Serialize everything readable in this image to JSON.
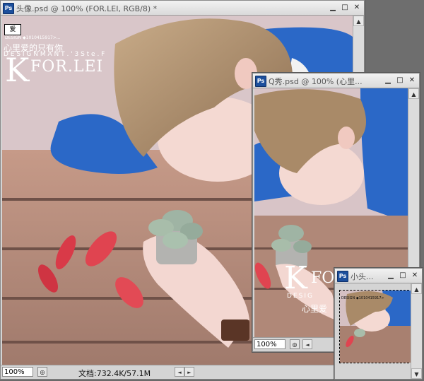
{
  "windows": {
    "main": {
      "title": "头像.psd @ 100% (FOR.LEI, RGB/8) *",
      "zoom": "100%",
      "doc_info": "文档:732.4K/57.1M"
    },
    "q": {
      "title": "Q秀.psd @ 100% (心里...",
      "zoom": "100%"
    },
    "small": {
      "title": "小头..."
    }
  },
  "overlay_text": {
    "main_small": "心里爱的只有你",
    "main_design": "D E S I G N   M A N T . ' 3 S   t e .   F",
    "main_k": "K",
    "main_forlei": "FOR.LEI",
    "main_qq": "DESIGN ◆1010415917>...",
    "main_logo": "爱",
    "q_k": "K",
    "q_for": "FO",
    "q_design": "DESIG",
    "q_small": "心里爱",
    "small_qq": "DESIGN ◆1010415917>"
  },
  "controls": {
    "minimize": "▁",
    "restore": "□",
    "close": "✕",
    "nav": "◎",
    "left": "◄",
    "right": "►",
    "up": "▲",
    "down": "▼"
  },
  "icons": {
    "ps": "Ps"
  },
  "colors": {
    "sweater": "#2b68c7",
    "wood": "#b88d7e",
    "petal": "#e04450",
    "hair": "#a98a68"
  }
}
